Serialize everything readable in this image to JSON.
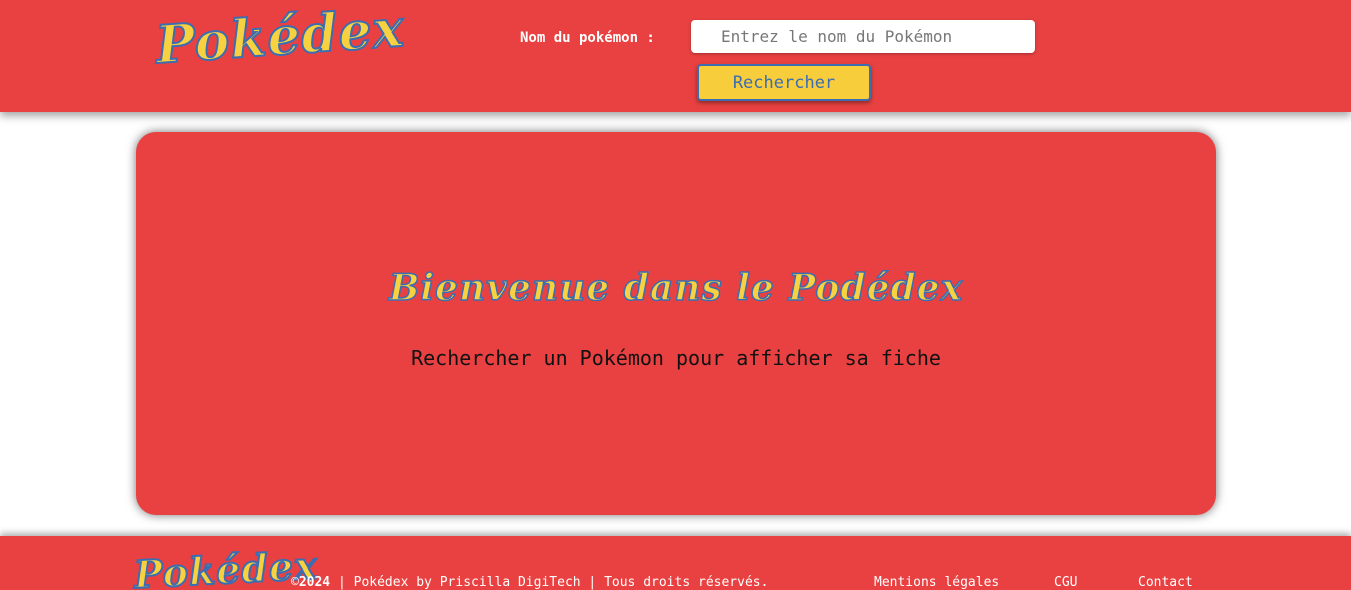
{
  "header": {
    "logo_text": "Pokédex",
    "search_label": "Nom du pokémon :",
    "search_placeholder": "Entrez le nom du Pokémon",
    "search_value": "",
    "search_button_label": "Rechercher"
  },
  "main": {
    "title": "Bienvenue dans le Podédex",
    "subtitle": "Rechercher un Pokémon pour afficher sa fiche"
  },
  "footer": {
    "logo_text": "Pokédex",
    "copyright_symbol": "©",
    "copyright_year": "2024",
    "copyright_text": " | Pokédex by Priscilla DigiTech | Tous droits réservés.",
    "links": [
      {
        "label": "Mentions légales"
      },
      {
        "label": "CGU"
      },
      {
        "label": "Contact"
      }
    ]
  },
  "colors": {
    "primary_red": "#e94141",
    "accent_yellow": "#f7cd3c",
    "accent_blue": "#3b6db3"
  }
}
